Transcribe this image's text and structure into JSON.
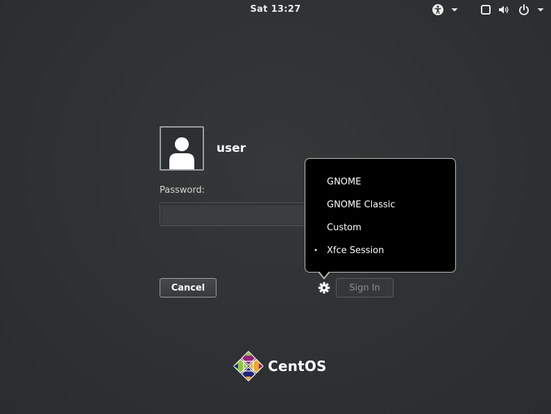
{
  "topbar": {
    "clock": "Sat 13:27",
    "icons": [
      "accessibility-icon",
      "chevron-down-icon",
      "display-icon",
      "volume-icon",
      "power-icon",
      "chevron-down-icon"
    ]
  },
  "login": {
    "username": "user",
    "password_label": "Password:",
    "password_value": "",
    "cancel_label": "Cancel",
    "signin_label": "Sign In"
  },
  "session_menu": {
    "items": [
      {
        "label": "GNOME",
        "selected": false
      },
      {
        "label": "GNOME Classic",
        "selected": false
      },
      {
        "label": "Custom",
        "selected": false
      },
      {
        "label": "Xfce Session",
        "selected": true
      }
    ],
    "selected_marker": "•"
  },
  "branding": {
    "logo_text": "CentOS",
    "colors": {
      "purple": "#932279",
      "green": "#8cc63e",
      "orange": "#efa724",
      "blue": "#262577"
    }
  }
}
